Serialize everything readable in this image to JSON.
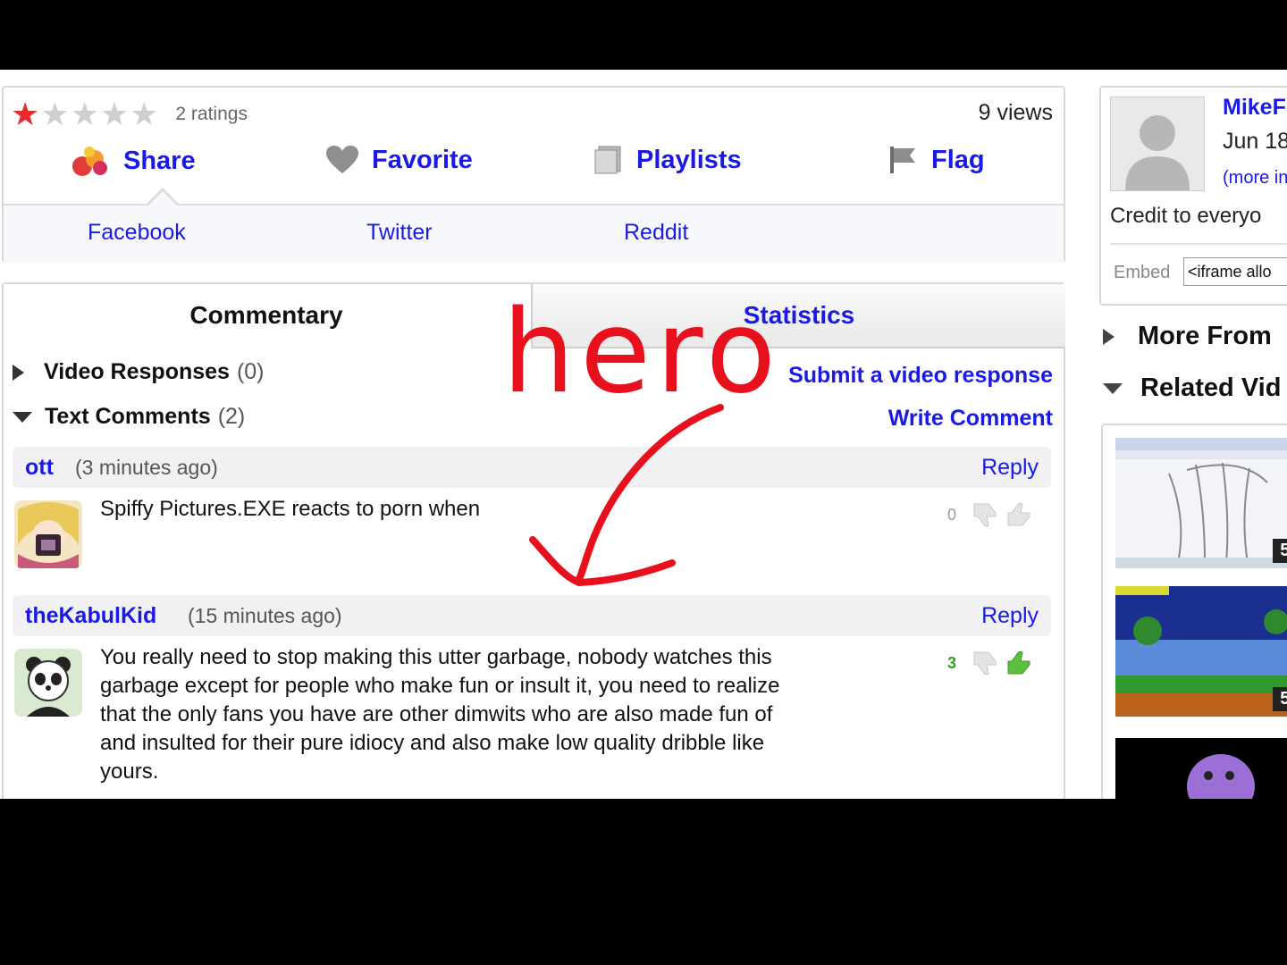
{
  "actions": {
    "rating": {
      "value": 1,
      "max": 5
    },
    "ratings_count": "2 ratings",
    "views": "9 views",
    "share_label": "Share",
    "favorite_label": "Favorite",
    "playlists_label": "Playlists",
    "flag_label": "Flag",
    "share_links": [
      "Facebook",
      "Twitter",
      "Reddit"
    ]
  },
  "tabs": {
    "commentary": "Commentary",
    "statistics": "Statistics"
  },
  "sections": {
    "video_responses": {
      "label": "Video Responses",
      "count": "(0)"
    },
    "text_comments": {
      "label": "Text Comments",
      "count": "(2)"
    },
    "submit_response": "Submit a video response",
    "write_comment": "Write Comment"
  },
  "comments": [
    {
      "author": "ott",
      "time": "(3 minutes ago)",
      "reply": "Reply",
      "text": "Spiffy Pictures.EXE reacts to porn when",
      "votes": "0"
    },
    {
      "author": "theKabulKid",
      "time": "(15 minutes ago)",
      "reply": "Reply",
      "text_lines": [
        "You really need to stop making this utter garbage, nobody watches this",
        "garbage except for people who make fun or insult it, you need to realize",
        "that the only fans you have are other dimwits who are also made fun of",
        "and insulted for their pure idiocy and also make low quality dribble like",
        "yours."
      ],
      "votes": "3"
    }
  ],
  "sidebar": {
    "owner_name": "MikeF",
    "date": "Jun 18",
    "more_info": "(more in",
    "description": "Credit to everyo",
    "embed_label": "Embed",
    "embed_value": "<iframe allo",
    "more_from": "More From",
    "related": "Related Vid",
    "thumb_durations": [
      "5:",
      "5:"
    ]
  },
  "annotation": {
    "text": "hero",
    "color": "#e8101c"
  }
}
